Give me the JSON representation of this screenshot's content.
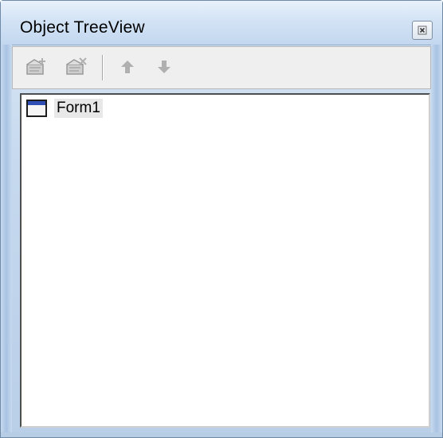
{
  "window": {
    "title": "Object TreeView"
  },
  "toolbar": {
    "buttons": [
      {
        "icon": "add-object-icon",
        "enabled": false
      },
      {
        "icon": "delete-object-icon",
        "enabled": false
      },
      {
        "icon": "move-up-icon",
        "enabled": false
      },
      {
        "icon": "move-down-icon",
        "enabled": false
      }
    ]
  },
  "tree": {
    "items": [
      {
        "label": "Form1",
        "icon": "form-icon",
        "selected": true
      }
    ]
  },
  "colors": {
    "titlebar": "#d3e3f5",
    "form_icon_bar": "#2f4fb4",
    "disabled_glyph": "#b0b0b0"
  }
}
